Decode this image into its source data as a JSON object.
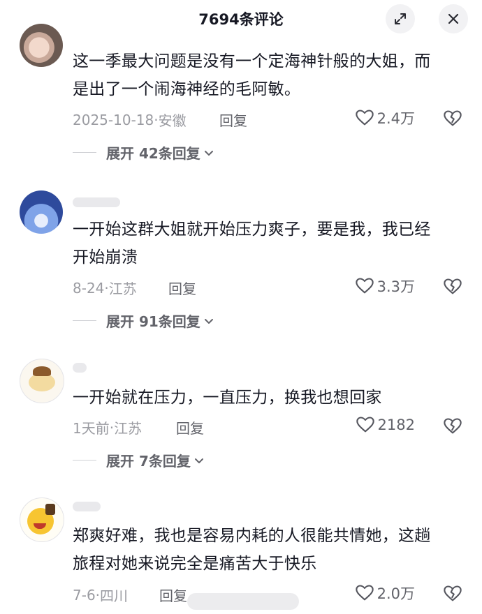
{
  "header": {
    "title": "7694条评论"
  },
  "comments": [
    {
      "text_line1": "这一季最大问题是没有一个定海神针般的大姐，而",
      "text_line2": "是出了一个闹海神经的毛阿敏。",
      "date": "2025-10-18",
      "location": "安徽",
      "reply_label": "回复",
      "likes": "2.4万",
      "expand_label": "展开 42条回复"
    },
    {
      "text_line1": "一开始这群大姐就开始压力爽子，要是我，我已经",
      "text_line2": "开始崩溃",
      "date": "8-24",
      "location": "江苏",
      "reply_label": "回复",
      "likes": "3.3万",
      "expand_label": "展开 91条回复"
    },
    {
      "text_line1": "一开始就在压力，一直压力，换我也想回家",
      "date": "1天前",
      "location": "江苏",
      "reply_label": "回复",
      "likes": "2182",
      "expand_label": "展开 7条回复"
    },
    {
      "text_line1": "郑爽好难，我也是容易内耗的人很能共情她，这趟",
      "text_line2": "旅程对她来说完全是痛苦大于快乐",
      "date": "7-6",
      "location": "四川",
      "reply_label": "回复",
      "likes": "2.0万"
    }
  ],
  "icons": {
    "expand": "expand-icon",
    "close": "close-icon",
    "like": "heart-icon",
    "dislike": "broken-heart-icon",
    "chevron": "chevron-down-icon"
  }
}
